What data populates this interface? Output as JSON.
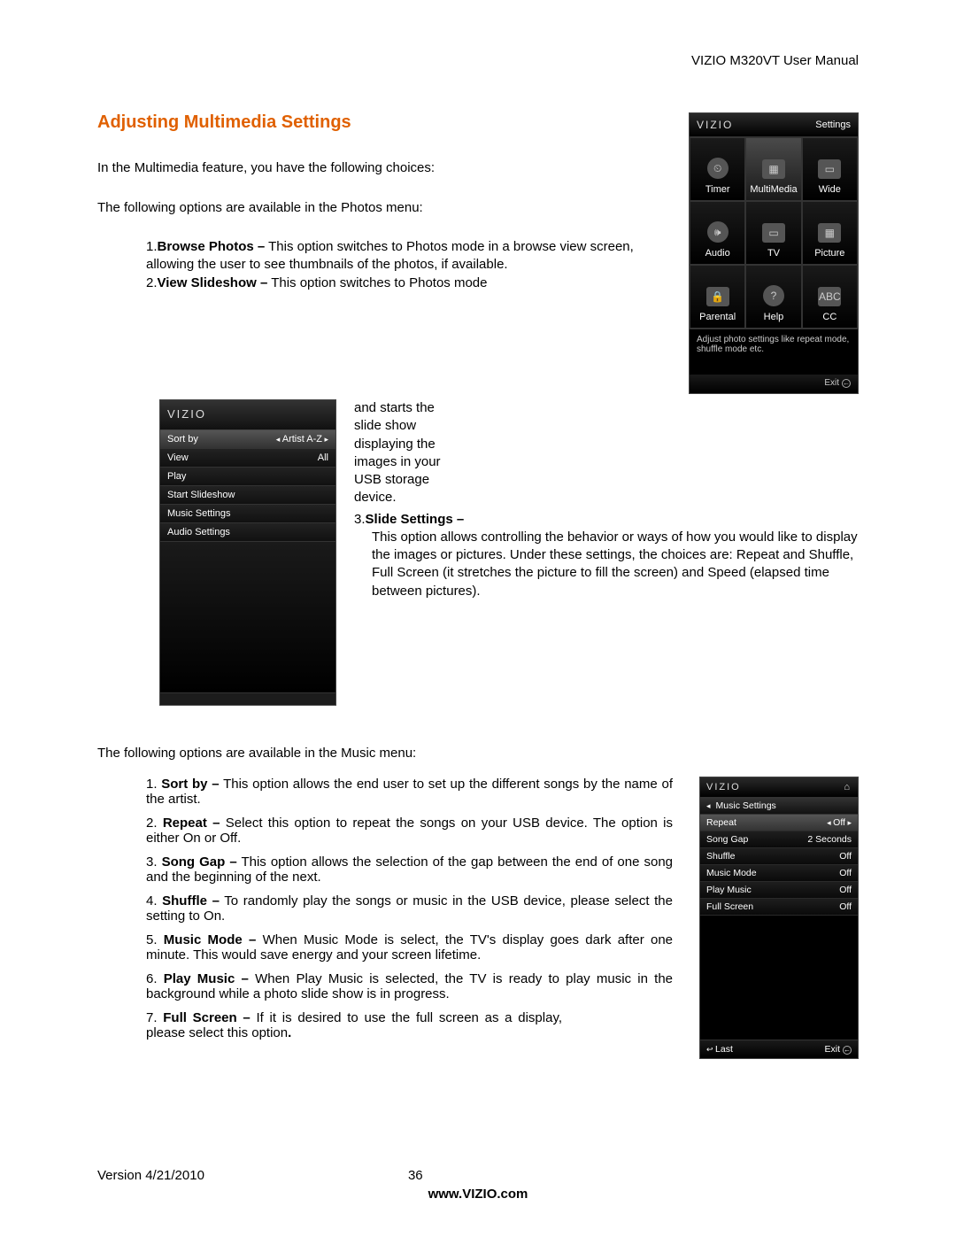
{
  "header": {
    "doc_title": "VIZIO M320VT User Manual"
  },
  "section": {
    "title": "Adjusting Multimedia Settings"
  },
  "intro": {
    "p1": "In the Multimedia feature, you have the following choices:",
    "p2": "The following options are available in the Photos menu:"
  },
  "photos_list": {
    "i1": {
      "num": "1.",
      "label": "Browse Photos –",
      "desc": " This option switches to Photos mode in a browse view screen, allowing the user to see thumbnails of the photos, if available."
    },
    "i2": {
      "num": "2.",
      "label": "View Slideshow –",
      "desc": " This option switches to Photos mode"
    },
    "i2_cont": "and starts the slide show displaying the images in your USB storage device.",
    "i3": {
      "num": "3.",
      "label": "Slide Settings –"
    },
    "i3_desc": "This option allows controlling the behavior or ways of how you would like to display the images or pictures. Under these settings, the choices are: Repeat and Shuffle, Full Screen (it stretches the picture to fill the screen) and Speed (elapsed time between pictures)."
  },
  "osd_settings": {
    "brand": "VIZIO",
    "title": "Settings",
    "cells": [
      {
        "label": "Timer",
        "icon": "⏲"
      },
      {
        "label": "MultiMedia",
        "icon": "▦"
      },
      {
        "label": "Wide",
        "icon": "▭"
      },
      {
        "label": "Audio",
        "icon": "🕪"
      },
      {
        "label": "TV",
        "icon": "▭"
      },
      {
        "label": "Picture",
        "icon": "▦"
      },
      {
        "label": "Parental",
        "icon": "🔒"
      },
      {
        "label": "Help",
        "icon": "?"
      },
      {
        "label": "CC",
        "icon": "ABC"
      }
    ],
    "hint": "Adjust photo settings like repeat mode, shuffle mode etc.",
    "exit": "Exit"
  },
  "menu1": {
    "brand": "VIZIO",
    "rows": [
      {
        "l": "Sort by",
        "r": "Artist A-Z",
        "sel": true,
        "arrows": true
      },
      {
        "l": "View",
        "r": "All"
      },
      {
        "l": "Play",
        "r": ""
      },
      {
        "l": "Start Slideshow",
        "r": ""
      },
      {
        "l": "Music Settings",
        "r": ""
      },
      {
        "l": "Audio Settings",
        "r": ""
      }
    ]
  },
  "music_intro": "The following options are available in the Music menu:",
  "music_list": {
    "i1": {
      "num": "1.",
      "label": "Sort by –",
      "desc": " This option allows the end user to set up the different songs by the name of the artist."
    },
    "i2": {
      "num": "2.",
      "label": "Repeat –",
      "desc": " Select this option to repeat the songs on your USB device. The option is either On or Off."
    },
    "i3": {
      "num": "3.",
      "label": "Song Gap –",
      "desc": " This option allows the selection of the gap between the end of one song and the beginning of the next."
    },
    "i4": {
      "num": "4.",
      "label": "Shuffle –",
      "desc": " To randomly play the songs or music in the USB device, please select the setting to On."
    },
    "i5": {
      "num": "5.",
      "label": "Music Mode –",
      "desc": " When Music Mode is select, the TV's display goes dark after one minute. This would save energy and your screen lifetime."
    },
    "i6": {
      "num": "6.",
      "label": "Play Music –",
      "desc": " When Play Music is selected, the TV is ready to play music in the background while a photo slide show is in progress."
    },
    "i7": {
      "num": "7.",
      "label": " Full Screen –",
      "desc": " If it is desired to use the full screen as a display, please select this option",
      "period": "."
    }
  },
  "osd_music": {
    "brand": "VIZIO",
    "crumb": "Music Settings",
    "rows": [
      {
        "l": "Repeat",
        "r": "Off",
        "sel": true,
        "arrows": true
      },
      {
        "l": "Song Gap",
        "r": "2 Seconds"
      },
      {
        "l": "Shuffle",
        "r": "Off"
      },
      {
        "l": "Music Mode",
        "r": "Off"
      },
      {
        "l": "Play Music",
        "r": "Off"
      },
      {
        "l": "Full Screen",
        "r": "Off"
      }
    ],
    "last": "Last",
    "exit": "Exit"
  },
  "footer": {
    "version": "Version 4/21/2010",
    "page": "36",
    "url": "www.VIZIO.com"
  }
}
